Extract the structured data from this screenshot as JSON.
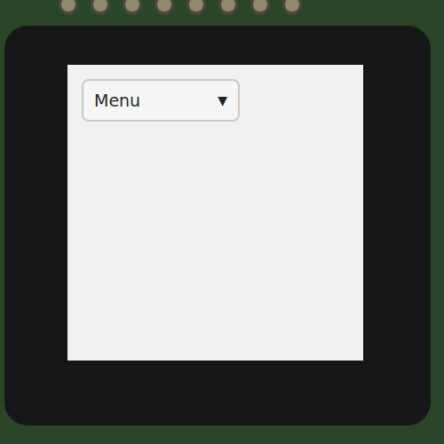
{
  "dropdown": {
    "label": "Menu",
    "icon": "▼",
    "expanded": false
  }
}
